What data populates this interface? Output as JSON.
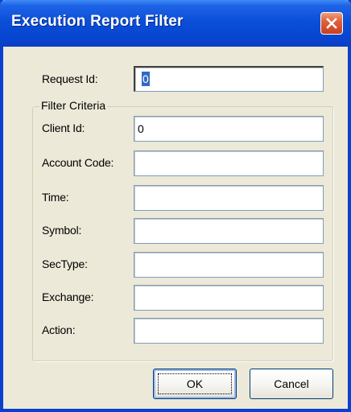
{
  "window": {
    "title": "Execution Report Filter"
  },
  "request": {
    "label": "Request Id:",
    "value": "0"
  },
  "filter": {
    "group_title": "Filter Criteria",
    "fields": [
      {
        "label": "Client Id:",
        "value": "0"
      },
      {
        "label": "Account Code:",
        "value": ""
      },
      {
        "label": "Time:",
        "value": ""
      },
      {
        "label": "Symbol:",
        "value": ""
      },
      {
        "label": "SecType:",
        "value": ""
      },
      {
        "label": "Exchange:",
        "value": ""
      },
      {
        "label": "Action:",
        "value": ""
      }
    ]
  },
  "buttons": {
    "ok": "OK",
    "cancel": "Cancel"
  },
  "icons": {
    "close": "close-icon"
  },
  "colors": {
    "titlebar": "#0a4fd8",
    "close": "#e0603a",
    "selection": "#316ac5"
  }
}
